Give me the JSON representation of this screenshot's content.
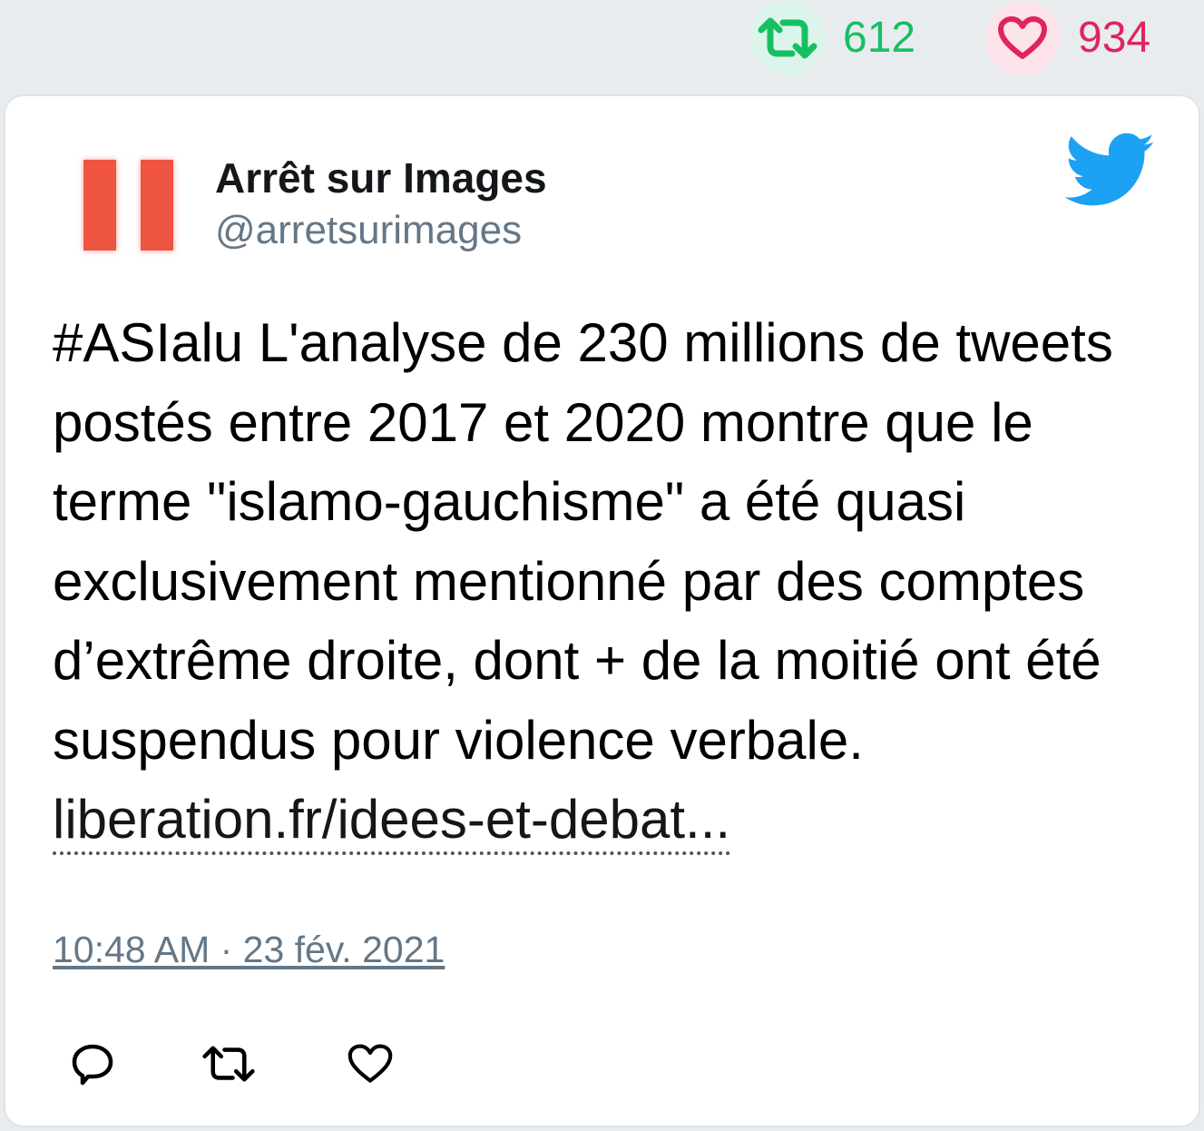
{
  "header_stats": {
    "retweets": "612",
    "likes": "934",
    "retweet_color": "#17bf63",
    "like_color": "#e0245e"
  },
  "tweet": {
    "author_name": "Arrêt sur Images",
    "author_handle": "@arretsurimages",
    "text_main": "#ASIalu L'analyse de 230 millions de tweets postés entre 2017 et 2020 montre que le terme \"islamo-gauchisme\" a été quasi exclusivement mentionné par des comptes d’extrême droite, dont + de la moitié ont été suspendus pour violence verbale.",
    "link_text": "liberation.fr/idees-et-debat...",
    "timestamp": "10:48 AM · 23 fév. 2021"
  },
  "icons": {
    "platform": "twitter-bird-icon",
    "avatar": "pause-logo-icon",
    "actions": [
      "reply-icon",
      "retweet-icon",
      "like-icon"
    ]
  },
  "colors": {
    "brand_blue": "#1da1f2",
    "avatar_red": "#ef5341",
    "muted_text": "#657786"
  }
}
